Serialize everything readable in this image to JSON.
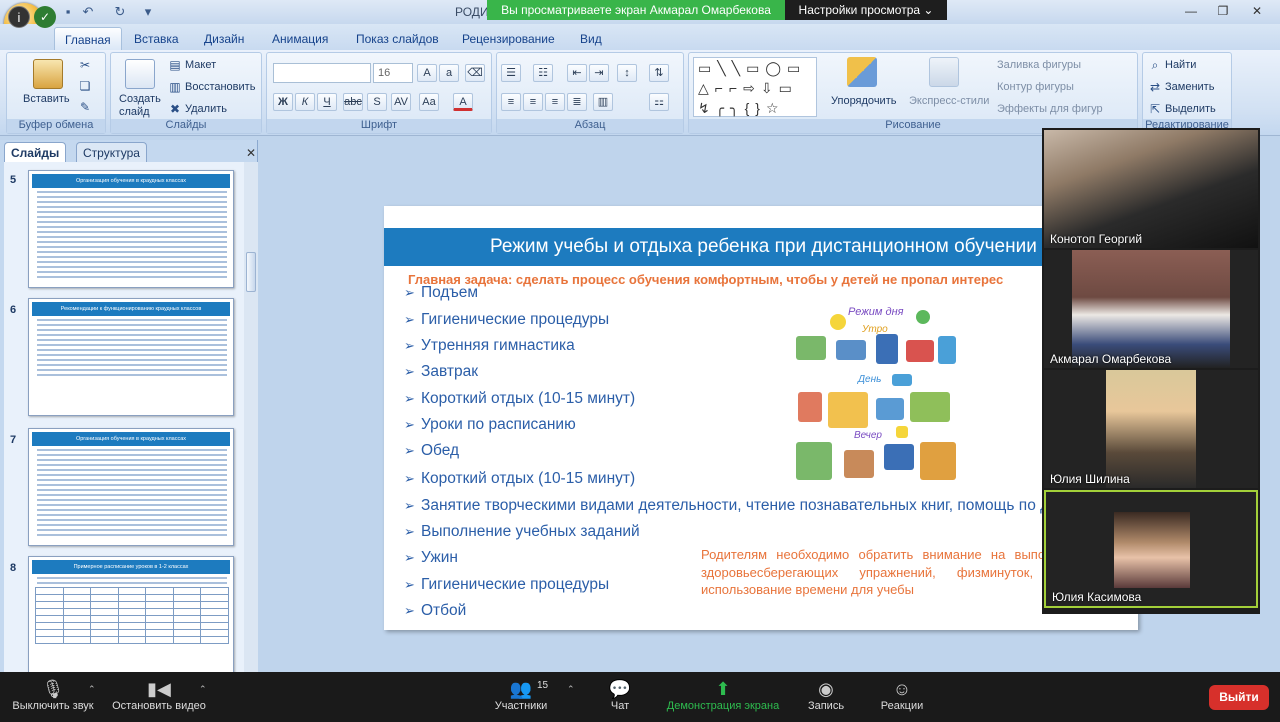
{
  "zoom": {
    "share_banner": "Вы просматриваете экран Акмарал Омарбекова",
    "view_options": "Настройки просмотра",
    "participants_count": "15",
    "toolbar": {
      "mute": "Выключить звук",
      "stop_video": "Остановить видео",
      "participants": "Участники",
      "chat": "Чат",
      "share_screen": "Демонстрация экрана",
      "record": "Запись",
      "reactions": "Реакции",
      "leave": "Выйти"
    },
    "participants": [
      {
        "name": "Конотоп Георгий"
      },
      {
        "name": "Акмарал Омарбекова"
      },
      {
        "name": "Юлия Шилина"
      },
      {
        "name": "Юлия Касимова"
      }
    ]
  },
  "ppt": {
    "window_title": "РОДИ",
    "tabs": [
      "Главная",
      "Вставка",
      "Дизайн",
      "Анимация",
      "Показ слайдов",
      "Рецензирование",
      "Вид"
    ],
    "ribbon": {
      "clipboard": {
        "paste": "Вставить",
        "label": "Буфер обмена"
      },
      "slides": {
        "new_slide": "Создать слайд",
        "layout": "Макет",
        "reset": "Восстановить",
        "delete": "Удалить",
        "label": "Слайды"
      },
      "font": {
        "size": "16",
        "label": "Шрифт"
      },
      "paragraph": {
        "label": "Абзац"
      },
      "drawing": {
        "arrange": "Упорядочить",
        "quick_styles": "Экспресс-стили",
        "fill": "Заливка фигуры",
        "outline": "Контур фигуры",
        "effects": "Эффекты для фигур",
        "label": "Рисование"
      },
      "editing": {
        "find": "Найти",
        "replace": "Заменить",
        "select": "Выделить",
        "label": "Редактирование"
      }
    },
    "pane_tabs": [
      "Слайды",
      "Структура"
    ],
    "thumbnails": [
      {
        "num": "5",
        "title": "Организация обучения в краудных классах"
      },
      {
        "num": "6",
        "title": "Рекомендации к функционированию краудных классов"
      },
      {
        "num": "7",
        "title": "Организация обучения в краудных классах"
      },
      {
        "num": "8",
        "title": "Примерное расписание уроков в 1-2 классах"
      }
    ],
    "slide": {
      "title": "Режим учебы и отдыха ребенка при дистанционном обучении",
      "subtitle": "Главная задача: сделать процесс обучения комфортным, чтобы  у детей не пропал интерес",
      "bullets": [
        "Подъем",
        "Гигиенические процедуры",
        "Утренняя гимнастика",
        "Завтрак",
        "Короткий отдых (10-15 минут)",
        "Уроки по расписанию",
        "Обед",
        "Короткий отдых (10-15 минут)",
        "Занятие творческими видами деятельности, чтение познавательных книг,  помощь по дому",
        "Выполнение учебных заданий",
        "Ужин",
        "Гигиенические процедуры",
        "Отбой"
      ],
      "note": "Родителям необходимо обратить внимание на выполнение детьми здоровьесберегающих упражнений, физминуток, рациональное использование времени для учебы",
      "collage": {
        "title": "Режим дня",
        "morning": "Утро",
        "day": "День",
        "evening": "Вечер"
      }
    }
  }
}
